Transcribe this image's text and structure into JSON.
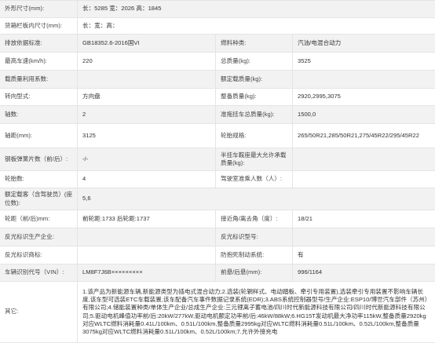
{
  "rows": [
    {
      "label": "外形尺寸(mm):",
      "value": "长：5285 宽：2026 高：1845"
    },
    {
      "label": "货箱栏板内尺寸(mm):",
      "value": "长：宽：高："
    },
    {
      "label": "排放依据标准:",
      "value": "GB18352.6-2016国VI",
      "label2": "燃料种类:",
      "value2": "汽油/电混合动力"
    },
    {
      "label": "最高车速(km/h):",
      "value": "220",
      "label2": "总质量(kg):",
      "value2": "3525"
    },
    {
      "label": "载质量利用系数:",
      "value": "",
      "label2": "额定载质量(kg):",
      "value2": ""
    },
    {
      "label": "转向型式:",
      "value": "方向盘",
      "label2": "整备质量(kg):",
      "value2": "2920,2995,3075"
    },
    {
      "label": "轴数:",
      "value": "2",
      "label2": "准拖挂车总质量(kg):",
      "value2": "1500,0"
    },
    {
      "label": "轴距(mm):",
      "value": "3125",
      "label2": "轮胎规格:",
      "value2": "265/50R21,285/50R21,275/45R22/295/45R22"
    },
    {
      "label": "钢板弹簧片数（前/后）:",
      "value": "-/-",
      "label2": "半挂车鞍座最大允许承载质量(kg):",
      "value2": ""
    },
    {
      "label": "轮胎数:",
      "value": "4",
      "label2": "驾驶室准乘人数（人）:",
      "value2": ""
    },
    {
      "label": "额定载客（含驾驶员）(座位数):",
      "value": "5,6"
    },
    {
      "label": "轮距（前/后)mm:",
      "value": "前轮距:1733 后轮距:1737",
      "label2": "接近角/离去角（度）:",
      "value2": "18/21"
    },
    {
      "label": "反光标识生产企业:",
      "value": "",
      "label2": "反光标识型号:",
      "value2": ""
    },
    {
      "label": "反光标识商标:",
      "value": "",
      "label2": "防抱死制动系统:",
      "value2": "有"
    },
    {
      "label": "车辆识别代号（VIN）:",
      "value": "LM8F7J6B×××××××××",
      "label2": "前悬/后悬(mm):",
      "value2": "996/1164"
    },
    {
      "label": "其它:",
      "value": "1.该产品为新能源车辆,新能源类型为插电式混合动力;2.选装(轮辋样式、电动踏板、牵引专用装置),选装牵引专用装置不影响车辆长度,该车型可选装ETC车载装置,该车配备汽车事件数据记录系统(EDR);3.ABS系统控制器型号/生产企业:ESP10/博世汽车部件（苏州）有限公司;4.储能装置种类/单体生产企业/总成生产企业:三元锂离子蓄电池/四川时代新能源科技有限公司/四川时代新能源科技有限公司;5.驱动电机峰值功率前/后:20kW/277kW,驱动电机额定功率前/后:46kW/88kW;6.HG15T发动机最大净功率115kW,整备质量2920kg对应WLTC燃料消耗量0.41L/100km、0.51L/100km,整备质量2995kg对应WLTC燃料消耗量0.51L/100km、0.52L/100km,整备质量3075kg对应WLTC燃料消耗量0.51L/100km、0.52L/100km;7.允许外接充电"
    }
  ]
}
